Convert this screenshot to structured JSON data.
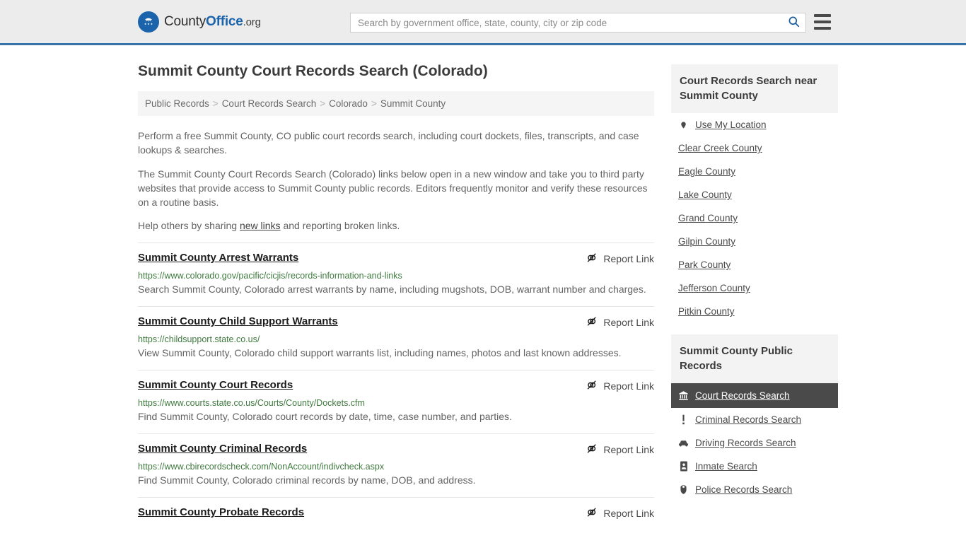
{
  "header": {
    "logo_text_1": "County",
    "logo_text_2": "Office",
    "logo_text_3": ".org",
    "logo_icon": "eagle-stars-seal-icon",
    "search_placeholder": "Search by government office, state, county, city or zip code",
    "search_value": "",
    "search_icon": "search-icon",
    "menu_icon": "hamburger-menu-icon",
    "accent_color": "#3a73a8",
    "header_bg": "#ececec"
  },
  "page": {
    "title": "Summit County Court Records Search (Colorado)"
  },
  "breadcrumb": {
    "separator": ">",
    "items": [
      {
        "label": "Public Records"
      },
      {
        "label": "Court Records Search"
      },
      {
        "label": "Colorado"
      },
      {
        "label": "Summit County"
      }
    ]
  },
  "intro": {
    "p1": "Perform a free Summit County, CO public court records search, including court dockets, files, transcripts, and case lookups & searches.",
    "p2": "The Summit County Court Records Search (Colorado) links below open in a new window and take you to third party websites that provide access to Summit County public records. Editors frequently monitor and verify these resources on a routine basis.",
    "p3_before": "Help others by sharing ",
    "p3_link": "new links",
    "p3_after": " and reporting broken links."
  },
  "results": {
    "report_label": "Report Link",
    "report_icon": "broken-link-icon",
    "items": [
      {
        "title": "Summit County Arrest Warrants",
        "url": "https://www.colorado.gov/pacific/cicjis/records-information-and-links",
        "description": "Search Summit County, Colorado arrest warrants by name, including mugshots, DOB, warrant number and charges."
      },
      {
        "title": "Summit County Child Support Warrants",
        "url": "https://childsupport.state.co.us/",
        "description": "View Summit County, Colorado child support warrants list, including names, photos and last known addresses."
      },
      {
        "title": "Summit County Court Records",
        "url": "https://www.courts.state.co.us/Courts/County/Dockets.cfm",
        "description": "Find Summit County, Colorado court records by date, time, case number, and parties."
      },
      {
        "title": "Summit County Criminal Records",
        "url": "https://www.cbirecordscheck.com/NonAccount/indivcheck.aspx",
        "description": "Find Summit County, Colorado criminal records by name, DOB, and address."
      },
      {
        "title": "Summit County Probate Records",
        "url": "",
        "description": ""
      }
    ]
  },
  "sidebar": {
    "nearby": {
      "heading": "Court Records Search near Summit County",
      "items": [
        {
          "label": "Use My Location",
          "icon": "map-pin-icon"
        },
        {
          "label": "Clear Creek County",
          "icon": ""
        },
        {
          "label": "Eagle County",
          "icon": ""
        },
        {
          "label": "Lake County",
          "icon": ""
        },
        {
          "label": "Grand County",
          "icon": ""
        },
        {
          "label": "Gilpin County",
          "icon": ""
        },
        {
          "label": "Park County",
          "icon": ""
        },
        {
          "label": "Jefferson County",
          "icon": ""
        },
        {
          "label": "Pitkin County",
          "icon": ""
        }
      ]
    },
    "public_records": {
      "heading": "Summit County Public Records",
      "active_bg": "#4a4a4a",
      "items": [
        {
          "label": "Court Records Search",
          "icon": "courthouse-icon",
          "active": true
        },
        {
          "label": "Criminal Records Search",
          "icon": "exclamation-icon",
          "active": false
        },
        {
          "label": "Driving Records Search",
          "icon": "car-icon",
          "active": false
        },
        {
          "label": "Inmate Search",
          "icon": "id-card-icon",
          "active": false
        },
        {
          "label": "Police Records Search",
          "icon": "police-badge-icon",
          "active": false
        }
      ]
    }
  }
}
